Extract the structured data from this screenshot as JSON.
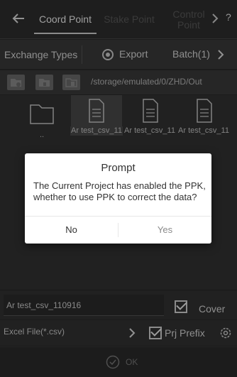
{
  "header": {
    "tabs": [
      {
        "label": "Coord Point",
        "active": true
      },
      {
        "label": "Stake Point",
        "active": false
      },
      {
        "label": "Control Point",
        "active": false
      }
    ],
    "help": "?"
  },
  "exchange": {
    "types_label": "Exchange Types",
    "export_label": "Export",
    "batch_label": "Batch(1)"
  },
  "toolbar": {
    "path": "/storage/emulated/0/ZHD/Out"
  },
  "files": [
    {
      "name": "..",
      "type": "folder",
      "selected": false
    },
    {
      "name": "Ar test_csv_11",
      "type": "file",
      "selected": true
    },
    {
      "name": "Ar test_csv_11",
      "type": "file",
      "selected": false
    },
    {
      "name": "Ar test_csv_11",
      "type": "file",
      "selected": false
    }
  ],
  "bottom": {
    "filename": "Ar test_csv_110916",
    "cover_label": "Cover",
    "cover_checked": true,
    "format": "Excel File(*.csv)",
    "prj_prefix_label": "Prj Prefix",
    "prj_prefix_checked": true,
    "ok_label": "OK"
  },
  "dialog": {
    "title": "Prompt",
    "message": "The Current Project has enabled the PPK, whether to use PPK to correct the data?",
    "no_label": "No",
    "yes_label": "Yes"
  },
  "colors": {
    "background": "#333333",
    "header": "#2f2f2f",
    "dialog": "#ffffff",
    "selected": "#4a4a4a"
  }
}
